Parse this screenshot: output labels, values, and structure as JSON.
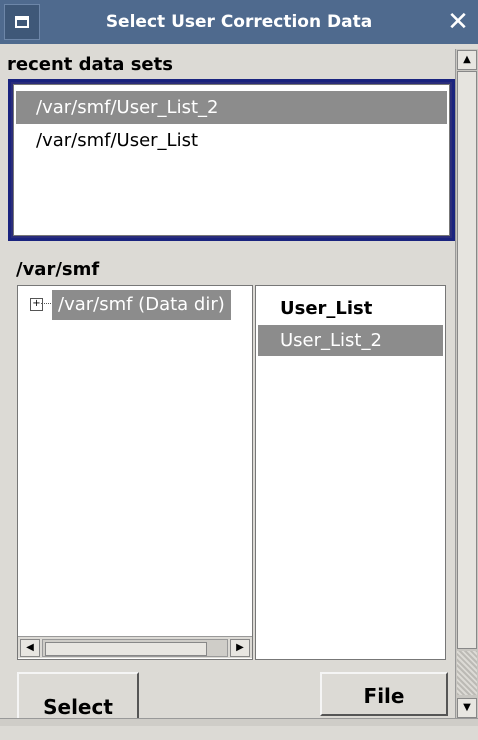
{
  "window": {
    "title": "Select User Correction Data",
    "menu_icon": "window-menu-icon",
    "close_glyph": "✕"
  },
  "recent": {
    "label": "recent data sets",
    "items": [
      "/var/smf/User_List_2",
      "/var/smf/User_List"
    ],
    "selected_index": 0
  },
  "browser": {
    "path_label": "/var/smf",
    "tree": {
      "expander": "+",
      "node_label": "/var/smf (Data dir)"
    },
    "files": [
      "User_List",
      "User_List_2"
    ],
    "selected_file_index": 1
  },
  "buttons": {
    "select": "Select",
    "file": "File"
  },
  "scroll": {
    "left": "◀",
    "right": "▶",
    "up": "▲",
    "down": "▼"
  },
  "colors": {
    "titlebar": "#4f6a8e",
    "selection": "#8c8c8c",
    "focus_border": "#1a237e"
  }
}
